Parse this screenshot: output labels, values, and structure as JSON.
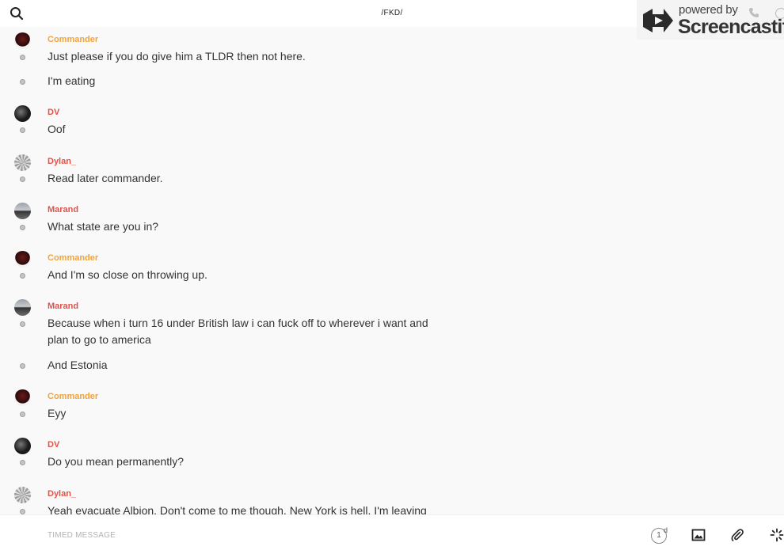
{
  "header": {
    "title": "/FKD/",
    "search_icon": "search-icon"
  },
  "watermark": {
    "line1": "powered by",
    "line2": "Screencastify"
  },
  "messages": {
    "m0": {
      "sender": "Commander",
      "color": "#f2a33a",
      "lines": [
        "Just please if you do give him a TLDR then not here.",
        "I'm eating"
      ]
    },
    "m1": {
      "sender": "DV",
      "color": "#e0534a",
      "lines": [
        "Oof"
      ]
    },
    "m2": {
      "sender": "Dylan_",
      "color": "#e0534a",
      "lines": [
        "Read later commander."
      ]
    },
    "m3": {
      "sender": "Marand",
      "color": "#e0534a",
      "lines": [
        "What state are you in?"
      ]
    },
    "m4": {
      "sender": "Commander",
      "color": "#f2a33a",
      "lines": [
        "And I'm so close on throwing up."
      ]
    },
    "m5": {
      "sender": "Marand",
      "color": "#e0534a",
      "lines": [
        "Because when i turn 16 under British law i can fuck off to wherever i want and plan to go to america",
        "And Estonia"
      ]
    },
    "m6": {
      "sender": "Commander",
      "color": "#f2a33a",
      "lines": [
        "Eyy"
      ]
    },
    "m7": {
      "sender": "DV",
      "color": "#e0534a",
      "lines": [
        "Do you mean permanently?"
      ]
    },
    "m8": {
      "sender": "Dylan_",
      "color": "#e0534a",
      "lines": [
        "Yeah evacuate Albion. Don't come to me though. New York is hell. I'm leaving"
      ]
    }
  },
  "composer": {
    "placeholder": "TIMED MESSAGE",
    "timer_value": "1",
    "timer_unit": "d",
    "image_icon": "image-icon",
    "attach_icon": "paperclip-icon",
    "effects_icon": "sparkle-icon"
  }
}
